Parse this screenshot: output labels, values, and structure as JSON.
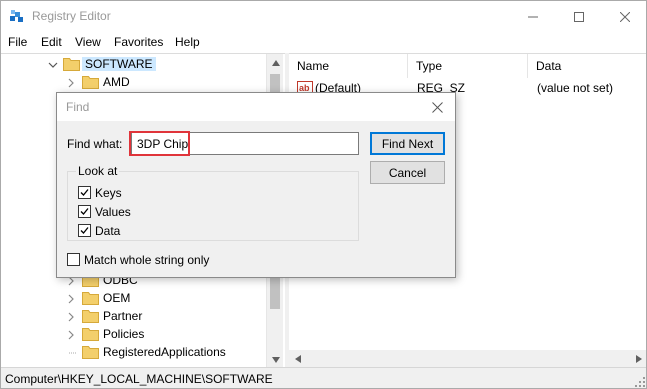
{
  "window": {
    "title": "Registry Editor",
    "controls": {
      "minimize": "minimize",
      "maximize": "maximize",
      "close": "close"
    }
  },
  "menu": [
    "File",
    "Edit",
    "View",
    "Favorites",
    "Help"
  ],
  "tree": {
    "items": [
      {
        "label": "SOFTWARE",
        "state": "expanded",
        "selected": true
      },
      {
        "label": "AMD",
        "state": "collapsed"
      },
      {
        "label": "ODBC",
        "state": "collapsed"
      },
      {
        "label": "OEM",
        "state": "collapsed"
      },
      {
        "label": "Partner",
        "state": "collapsed"
      },
      {
        "label": "Policies",
        "state": "collapsed"
      },
      {
        "label": "RegisteredApplications",
        "state": "leaf"
      }
    ]
  },
  "list": {
    "columns": [
      "Name",
      "Type",
      "Data"
    ],
    "rows": [
      {
        "name": "(Default)",
        "type": "REG_SZ",
        "data": "(value not set)"
      }
    ]
  },
  "status": {
    "path": "Computer\\HKEY_LOCAL_MACHINE\\SOFTWARE"
  },
  "find_dialog": {
    "title": "Find",
    "find_what_label": "Find what:",
    "find_what_value": "3DP Chip",
    "find_next_label": "Find Next",
    "cancel_label": "Cancel",
    "look_at_label": "Look at",
    "options": [
      {
        "label": "Keys",
        "checked": true
      },
      {
        "label": "Values",
        "checked": true
      },
      {
        "label": "Data",
        "checked": true
      }
    ],
    "match_whole_label": "Match whole string only",
    "match_whole_checked": false
  },
  "colors": {
    "selection": "#cce8ff",
    "folder": "#f3cf6b",
    "highlight": "#e0343a",
    "default_button_border": "#0078d7"
  }
}
